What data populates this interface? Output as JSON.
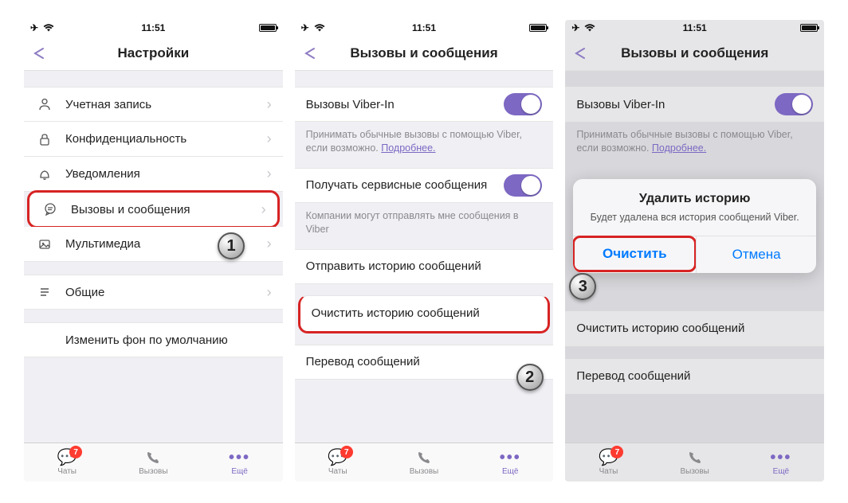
{
  "status": {
    "time": "11:51"
  },
  "screen1": {
    "title": "Настройки",
    "items": {
      "account": "Учетная запись",
      "privacy": "Конфиденциальность",
      "notifications": "Уведомления",
      "calls_messages": "Вызовы и сообщения",
      "multimedia": "Мультимедиа",
      "general": "Общие",
      "change_bg": "Изменить фон по умолчанию"
    }
  },
  "screen2": {
    "title": "Вызовы и сообщения",
    "viber_in": "Вызовы Viber-In",
    "viber_in_desc": "Принимать обычные вызовы с помощью Viber, если возможно. ",
    "learn_more": "Подробнее.",
    "service_msg": "Получать сервисные сообщения",
    "service_desc": "Компании могут отправлять мне сообщения в Viber",
    "send_history": "Отправить историю сообщений",
    "clear_history": "Очистить историю сообщений",
    "translate": "Перевод сообщений"
  },
  "screen3": {
    "title": "Вызовы и сообщения",
    "sheet_title": "Удалить историю",
    "sheet_msg": "Будет удалена вся история сообщений Viber.",
    "clear": "Очистить",
    "cancel": "Отмена"
  },
  "tabs": {
    "chats": "Чаты",
    "calls": "Вызовы",
    "more": "Ещё",
    "badge": "7"
  },
  "steps": {
    "s1": "1",
    "s2": "2",
    "s3": "3"
  }
}
